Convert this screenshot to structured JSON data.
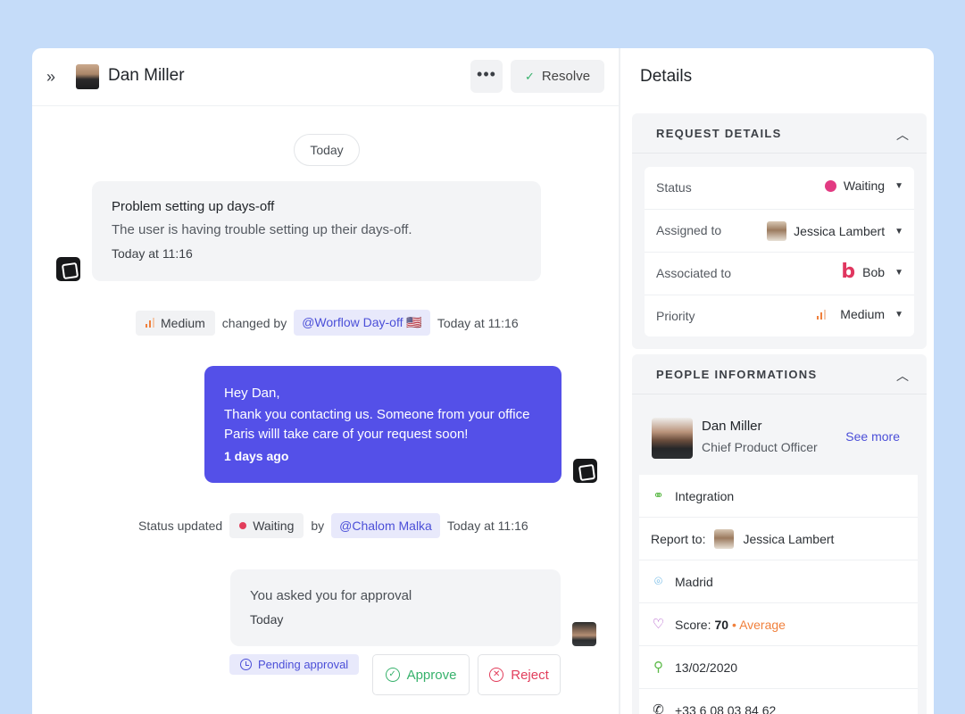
{
  "chat": {
    "user_name": "Dan Miller",
    "more_label": "•••",
    "resolve_label": "Resolve",
    "day_label": "Today",
    "message1": {
      "title": "Problem setting up days-off",
      "body": "The user is having trouble setting up their days-off.",
      "time": "Today at 11:16"
    },
    "event1": {
      "priority": "Medium",
      "changed_by": "changed by",
      "mention": "@Worflow Day-off 🇺🇸",
      "time": "Today at 11:16"
    },
    "message2": {
      "line1": "Hey Dan,",
      "line2": "Thank you contacting us. Someone from your office",
      "line3": "Paris willl take care of your request soon!",
      "time": "1 days ago"
    },
    "event2": {
      "prefix": "Status updated",
      "status": "Waiting",
      "by": "by",
      "mention": "@Chalom Malka",
      "time": "Today at 11:16"
    },
    "message3": {
      "body": "You asked you for approval",
      "time": "Today"
    },
    "pending_label": "Pending approval",
    "approve_label": "Approve",
    "reject_label": "Reject"
  },
  "details": {
    "title": "Details",
    "request": {
      "heading": "REQUEST DETAILS",
      "rows": [
        {
          "label": "Status",
          "value": "Waiting"
        },
        {
          "label": "Assigned to",
          "value": "Jessica Lambert"
        },
        {
          "label": "Associated to",
          "value": "Bob"
        },
        {
          "label": "Priority",
          "value": "Medium"
        }
      ]
    },
    "people": {
      "heading": "PEOPLE INFORMATIONS",
      "name": "Dan Miller",
      "role": "Chief Product Officer",
      "see_more": "See more",
      "integration": "Integration",
      "report_label": "Report to:",
      "report_name": "Jessica Lambert",
      "location": "Madrid",
      "score_label": "Score:",
      "score_value": "70",
      "score_text": "• Average",
      "date": "13/02/2020",
      "phone": "+33 6 08 03 84 62"
    }
  },
  "colors": {
    "background": "#c5dcf9",
    "accent": "#5450e8",
    "approve": "#37b26c",
    "reject": "#e23d5b",
    "priority": "#f0803c",
    "status_waiting": "#e23a82"
  }
}
